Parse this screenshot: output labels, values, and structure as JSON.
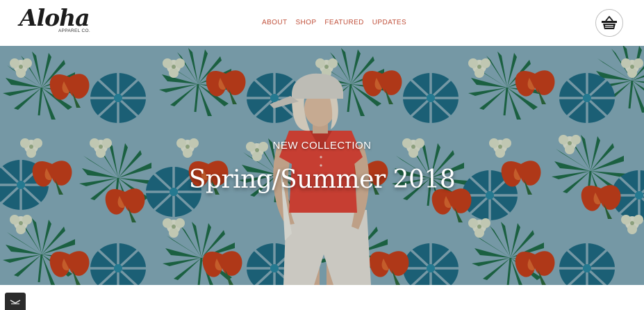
{
  "brand": {
    "name": "Aloha",
    "tagline": "APPAREL CO."
  },
  "nav": {
    "items": [
      "ABOUT",
      "SHOP",
      "FEATURED",
      "UPDATES"
    ]
  },
  "header": {
    "cart_icon": "shopping-basket-icon"
  },
  "hero": {
    "eyebrow": "NEW COLLECTION",
    "title": "Spring/Summer 2018",
    "background_pattern": "tropical-leaves-and-flowers",
    "colors": {
      "sky": "#86aebc",
      "leaf_dark": "#1f6e4a",
      "leaf_teal": "#1f6d86",
      "flower_red": "#c8401c",
      "shirt": "#e2473a"
    }
  },
  "widgets": {
    "chat_icon": "chat-toggle-icon"
  },
  "colors": {
    "nav_link": "#c0513c",
    "logo": "#1c1c1c"
  }
}
